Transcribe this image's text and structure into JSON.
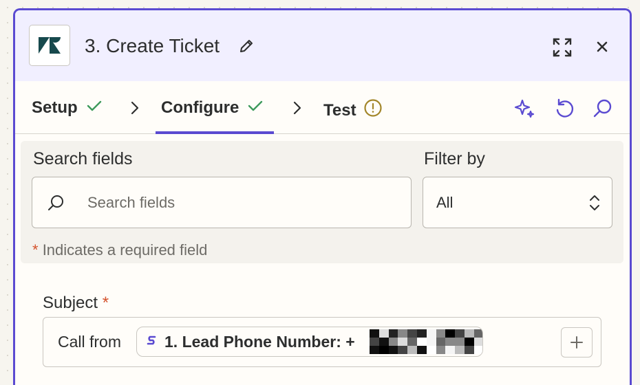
{
  "header": {
    "title": "3. Create Ticket",
    "app_icon": "zendesk-logo",
    "actions": [
      "expand-icon",
      "close-icon"
    ]
  },
  "tabs": [
    {
      "label": "Setup",
      "status": "complete"
    },
    {
      "label": "Configure",
      "status": "complete",
      "active": true
    },
    {
      "label": "Test",
      "status": "warning"
    }
  ],
  "toolbar_icons": [
    "sparkle-icon",
    "refresh-icon",
    "search-icon"
  ],
  "filters": {
    "search_label": "Search fields",
    "search_placeholder": "Search fields",
    "filter_label": "Filter by",
    "filter_value": "All",
    "required_star": "*",
    "required_note": "Indicates a required field"
  },
  "fields": {
    "subject": {
      "label": "Subject",
      "required_star": "*",
      "prefix_text": "Call from",
      "token_text": "1. Lead Phone Number: +"
    }
  },
  "colors": {
    "accent": "#5a4ad1",
    "check": "#3d9a5c",
    "warning": "#a3862a",
    "required": "#d4522c"
  }
}
